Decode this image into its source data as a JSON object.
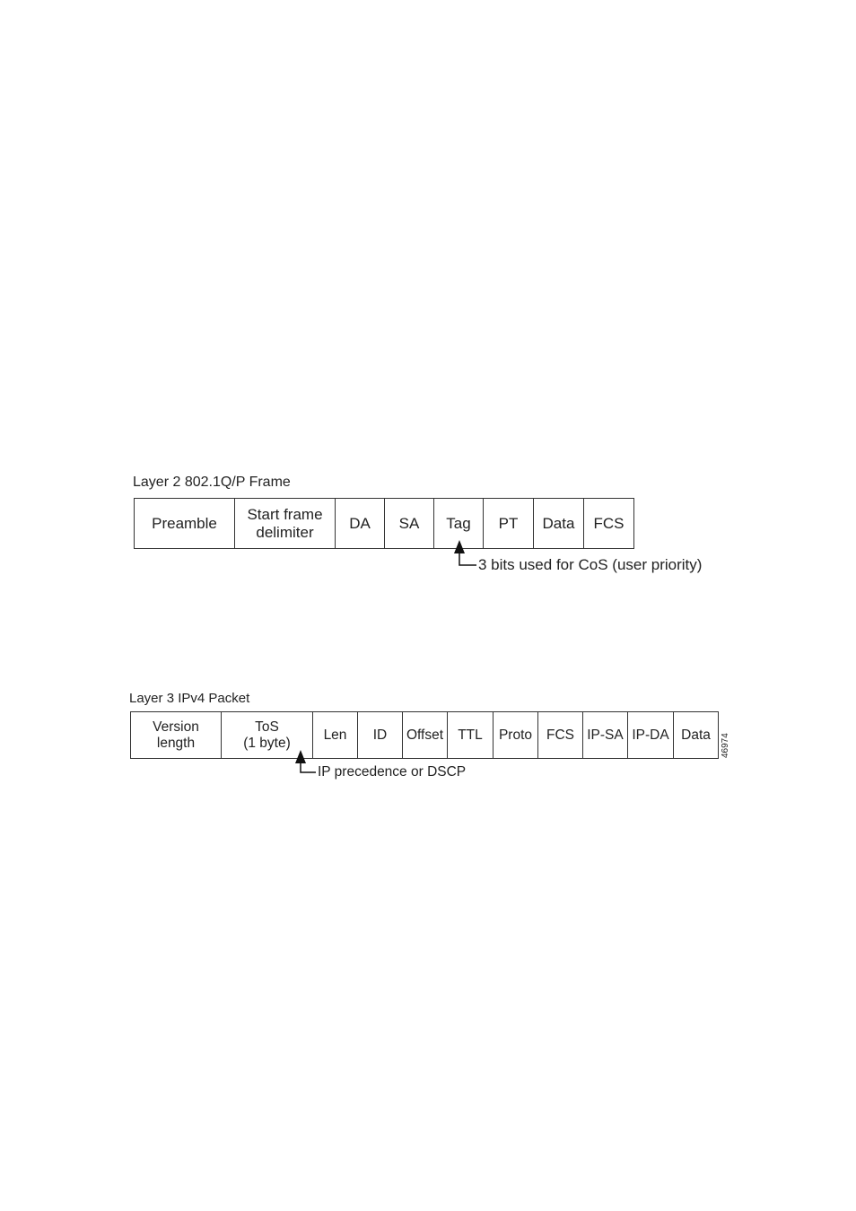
{
  "layer2": {
    "title": "Layer 2 802.1Q/P Frame",
    "fields": [
      {
        "label": "Preamble"
      },
      {
        "label": "Start frame\ndelimiter"
      },
      {
        "label": "DA"
      },
      {
        "label": "SA"
      },
      {
        "label": "Tag"
      },
      {
        "label": "PT"
      },
      {
        "label": "Data"
      },
      {
        "label": "FCS"
      }
    ],
    "callout": {
      "target": "Tag",
      "text": "3 bits used for CoS (user priority)"
    }
  },
  "layer3": {
    "title": "Layer 3 IPv4 Packet",
    "fields": [
      {
        "label": "Version\nlength"
      },
      {
        "label": "ToS\n(1 byte)"
      },
      {
        "label": "Len"
      },
      {
        "label": "ID"
      },
      {
        "label": "Offset"
      },
      {
        "label": "TTL"
      },
      {
        "label": "Proto"
      },
      {
        "label": "FCS"
      },
      {
        "label": "IP-SA"
      },
      {
        "label": "IP-DA"
      },
      {
        "label": "Data"
      }
    ],
    "callout": {
      "target": "ToS (1 byte)",
      "text": "IP precedence or DSCP"
    }
  },
  "figure_id": "46974"
}
